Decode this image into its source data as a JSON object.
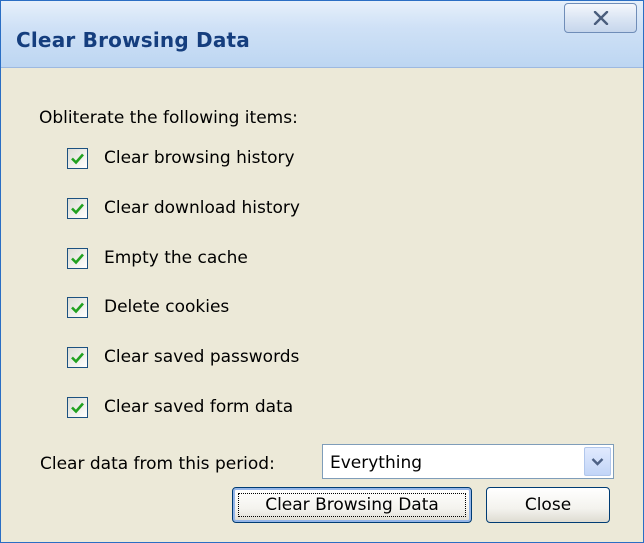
{
  "window": {
    "title": "Clear Browsing Data"
  },
  "heading": "Obliterate the following items:",
  "items": [
    {
      "label": "Clear browsing history",
      "checked": true
    },
    {
      "label": "Clear download history",
      "checked": true
    },
    {
      "label": "Empty the cache",
      "checked": true
    },
    {
      "label": "Delete cookies",
      "checked": true
    },
    {
      "label": "Clear saved passwords",
      "checked": true
    },
    {
      "label": "Clear saved form data",
      "checked": true
    }
  ],
  "period": {
    "label": "Clear data from this period:",
    "selected": "Everything"
  },
  "buttons": {
    "clear": "Clear Browsing Data",
    "close": "Close"
  },
  "icons": {
    "close": "close-icon",
    "check": "checkmark-icon",
    "dropdown": "chevron-down-icon"
  },
  "colors": {
    "title_text": "#153e7e",
    "checkmark": "#21a121",
    "window_bg": "#ece9d8"
  }
}
